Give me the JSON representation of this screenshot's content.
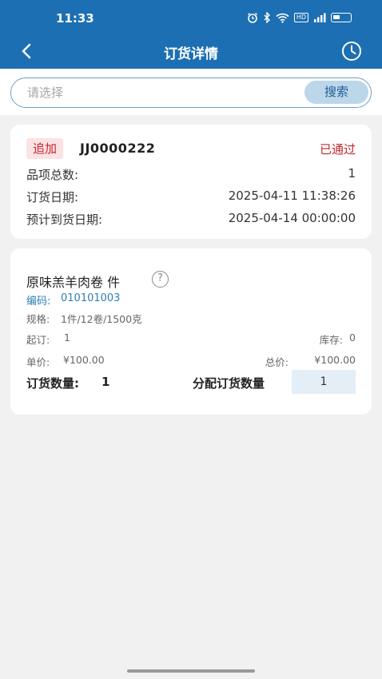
{
  "status_bar": {
    "time": "11:33",
    "icons": [
      "alarm-icon",
      "bluetooth-icon",
      "wifi-icon",
      "hd-icon",
      "signal-icon",
      "battery-icon"
    ],
    "hd_label": "HD"
  },
  "nav": {
    "title": "订货详情",
    "back_icon": "chevron-left-icon",
    "history_icon": "clock-icon"
  },
  "search": {
    "placeholder": "请选择",
    "value": "",
    "button_label": "搜索"
  },
  "order": {
    "tag": "追加",
    "number": "JJ0000222",
    "status": "已通过",
    "rows": [
      {
        "label": "品项总数:",
        "value": "1"
      },
      {
        "label": "订货日期:",
        "value": "2025-04-11 11:38:26"
      },
      {
        "label": "预计到货日期:",
        "value": "2025-04-14 00:00:00"
      }
    ]
  },
  "item": {
    "name": "原味羔羊肉卷 件",
    "help_icon": "question-circle-icon",
    "help_glyph": "?",
    "code_label": "编码:",
    "code": "010101003",
    "spec_label": "规格:",
    "spec": "1件/12卷/1500克",
    "min_order_label": "起订:",
    "min_order": "1",
    "stock_label": "库存:",
    "stock": "0",
    "unit_price_label": "单价:",
    "unit_price": "¥100.00",
    "total_price_label": "总价:",
    "total_price": "¥100.00",
    "order_qty_label": "订货数量:",
    "order_qty": "1",
    "alloc_qty_label": "分配订货数量",
    "alloc_qty": "1"
  },
  "colors": {
    "brand": "#1c6fb2",
    "status_red": "#c3262e",
    "link_blue": "#2f7fb5"
  }
}
